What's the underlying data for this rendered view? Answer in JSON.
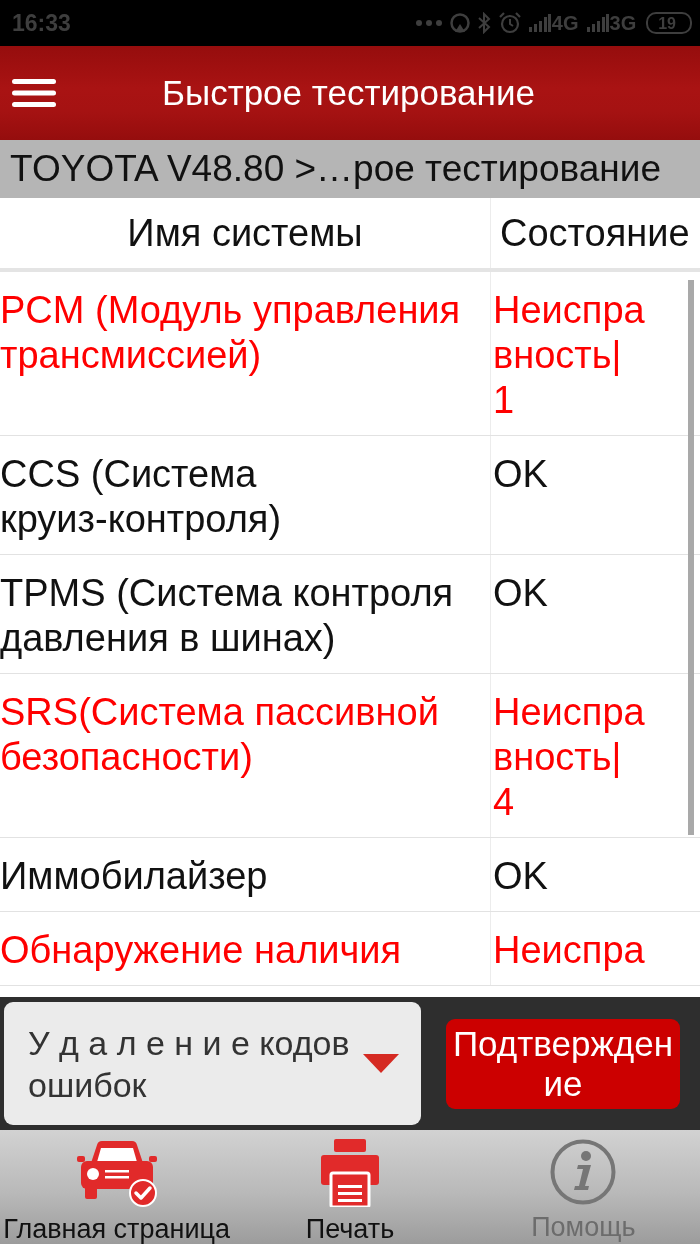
{
  "status_bar": {
    "time": "16:33",
    "network_1": "4G",
    "network_2": "3G",
    "battery": "19"
  },
  "toolbar": {
    "title": "Быстрое тестирование"
  },
  "breadcrumb": "TOYOTA V48.80 >…рое тестирование",
  "table": {
    "columns": [
      "Имя системы",
      "Состояние"
    ],
    "rows": [
      {
        "name": "PCM (Модуль управления трансмиссией)",
        "status": "Неисправность|\n1",
        "fault": true
      },
      {
        "name": "CCS (Система круиз-контроля)",
        "status": "OK",
        "fault": false
      },
      {
        "name": "TPMS (Система контроля давления в шинах)",
        "status": "OK",
        "fault": false
      },
      {
        "name": "SRS(Система пассивной безопасности)",
        "status": "Неисправность|\n4",
        "fault": true
      },
      {
        "name": "Иммобилайзер",
        "status": "OK",
        "fault": false
      },
      {
        "name": "Обнаружение наличия",
        "status": "Неиспра",
        "fault": true
      }
    ]
  },
  "action_bar": {
    "dropdown": {
      "value": "У д а л е н и е кодов ошибок"
    },
    "confirm_button": "Подтверждение"
  },
  "bottom_nav": [
    {
      "kind": "home",
      "label": "Главная страница",
      "disabled": false
    },
    {
      "kind": "print",
      "label": "Печать",
      "disabled": false
    },
    {
      "kind": "help",
      "label": "Помощь",
      "disabled": true
    }
  ]
}
